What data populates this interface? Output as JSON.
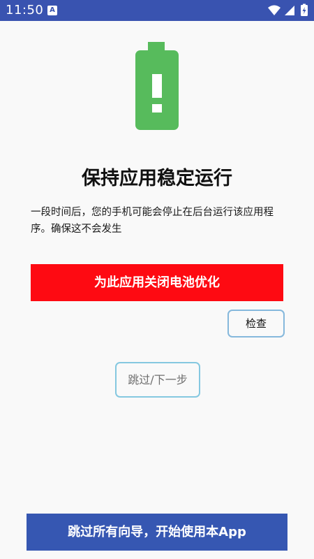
{
  "status_bar": {
    "time": "11:50",
    "notification_icon_letter": "A",
    "icons": [
      "wifi-icon",
      "cell-signal-icon",
      "battery-charging-icon"
    ],
    "background_color": "#3953b0"
  },
  "illustration": {
    "icon": "battery-warning-icon",
    "color": "#57bb5c"
  },
  "main": {
    "title": "保持应用稳定运行",
    "description": "一段时间后，您的手机可能会停止在后台运行该应用程序。确保这不会发生",
    "disable_battery_optimization_button": "为此应用关闭电池优化",
    "check_button": "检查",
    "skip_next_button": "跳过/下一步"
  },
  "footer": {
    "skip_all_button": "跳过所有向导，开始使用本App"
  },
  "colors": {
    "primary_button": "#fe0a12",
    "footer_button": "#3657b2",
    "outline": "#85b8dc"
  }
}
